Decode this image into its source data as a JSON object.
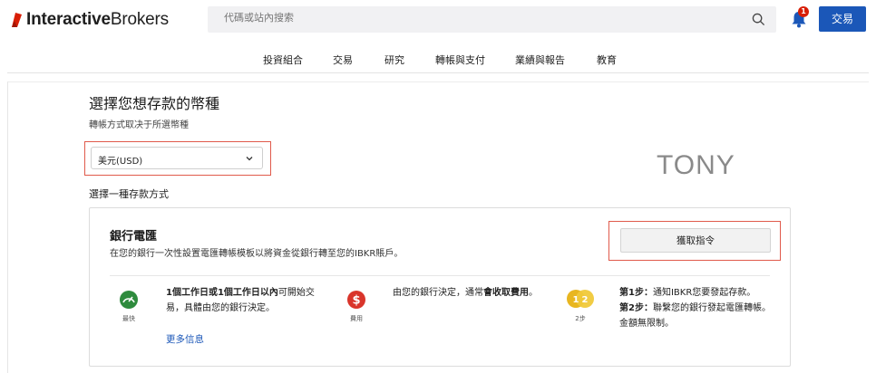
{
  "brand": {
    "logo_bold": "Interactive",
    "logo_light": "Brokers",
    "logo_mark_color": "#d81e06"
  },
  "search": {
    "placeholder": "代碼或站內搜索"
  },
  "header": {
    "notification_count": "1",
    "trade_button": "交易"
  },
  "nav": {
    "items": [
      "投資組合",
      "交易",
      "研究",
      "轉帳與支付",
      "業績與報告",
      "教育"
    ]
  },
  "page": {
    "title": "選擇您想存款的幣種",
    "subtitle": "轉帳方式取决于所選幣種",
    "currency_select": {
      "value": "美元(USD)"
    },
    "watermark": "TONY",
    "method_heading": "選擇一種存款方式"
  },
  "card": {
    "title": "銀行電匯",
    "description": "在您的銀行一次性設置電匯轉帳模板以將資金從銀行轉至您的IBKR賬戶。",
    "action_button": "獲取指令",
    "features": [
      {
        "icon": "speedometer-icon",
        "caption": "最快",
        "text_bold": "1個工作日或1個工作日以內",
        "text_rest": "可開始交易，具體由您的銀行決定。",
        "color": "#2e8b3d"
      },
      {
        "icon": "dollar-icon",
        "caption": "費用",
        "text_pre": "由您的銀行決定，通常",
        "text_bold": "會收取費用",
        "text_post": "。",
        "color": "#d9352b"
      },
      {
        "icon": "steps-icon",
        "caption": "2步",
        "step1_label": "第1步：",
        "step1_text": "通知IBKR您要發起存款。",
        "step2_label": "第2步：",
        "step2_text": "聯繫您的銀行發起電匯轉帳。金額無限制。",
        "color": "#e8b620"
      }
    ],
    "more_link": "更多信息"
  }
}
